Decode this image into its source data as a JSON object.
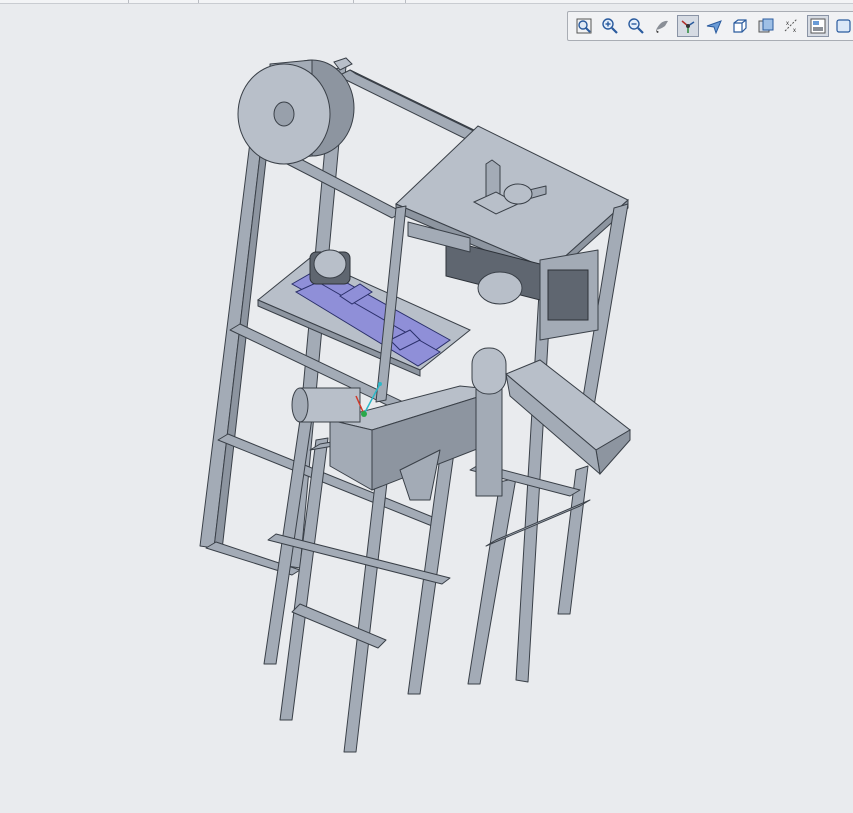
{
  "app": {
    "background_color": "#e9ebee",
    "model_color": "#a3abb6",
    "highlight_color": "#8f8fd8"
  },
  "toolbar": {
    "buttons": [
      {
        "name": "refit-icon",
        "active": false
      },
      {
        "name": "zoom-in-icon",
        "active": false
      },
      {
        "name": "zoom-out-icon",
        "active": false
      },
      {
        "name": "repaint-icon",
        "active": false
      },
      {
        "name": "spin-center-icon",
        "active": true
      },
      {
        "name": "orient-mode-icon",
        "active": false
      },
      {
        "name": "saved-views-icon",
        "active": false
      },
      {
        "name": "display-style-icon",
        "active": false
      },
      {
        "name": "datum-display-icon",
        "active": false
      },
      {
        "name": "view-manager-icon",
        "active": true
      },
      {
        "name": "appearance-icon",
        "active": false
      }
    ]
  }
}
